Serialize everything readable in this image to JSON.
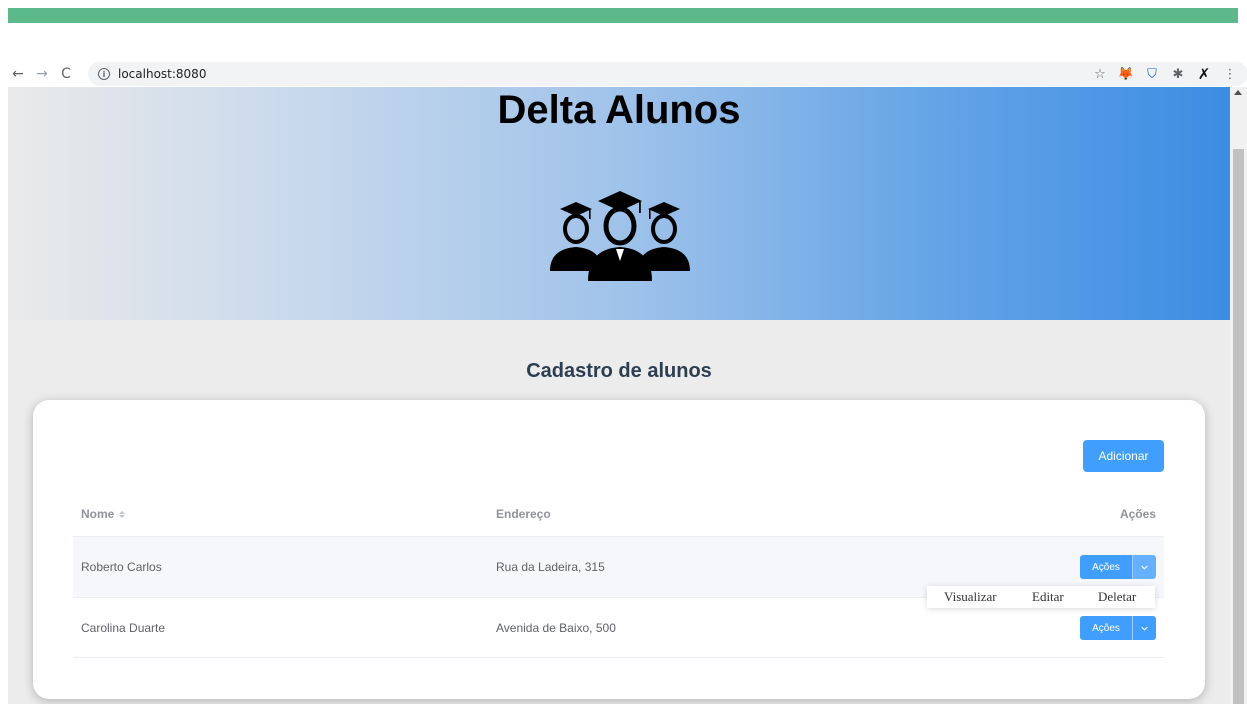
{
  "browser": {
    "url": "localhost:8080",
    "nav": {
      "back": "←",
      "forward": "→",
      "reload": "C",
      "info": "i"
    },
    "extensions": [
      "star-icon",
      "metamask-icon",
      "bitwarden-icon",
      "puzzle-icon",
      "custom-extension-icon",
      "menu-icon"
    ],
    "ext_glyphs": {
      "star": "☆",
      "fox": "🦊",
      "shield": "⛉",
      "puzzle": "✱",
      "x": "✗",
      "menu": "⋮"
    }
  },
  "hero": {
    "title": "Delta Alunos",
    "icon": "graduates-icon"
  },
  "section": {
    "title": "Cadastro de alunos"
  },
  "toolbar": {
    "add_label": "Adicionar"
  },
  "table": {
    "columns": [
      "Nome",
      "Endereço",
      "Ações"
    ],
    "rows": [
      {
        "name": "Roberto Carlos",
        "address": "Rua da Ladeira, 315",
        "action_label": "Ações"
      },
      {
        "name": "Carolina Duarte",
        "address": "Avenida de Baixo, 500",
        "action_label": "Ações"
      }
    ]
  },
  "dropdown": {
    "items": [
      "Visualizar",
      "Editar",
      "Deletar"
    ]
  },
  "colors": {
    "accent": "#409eff",
    "top_strip": "#5cb98a",
    "title_text": "#2c3e50"
  }
}
